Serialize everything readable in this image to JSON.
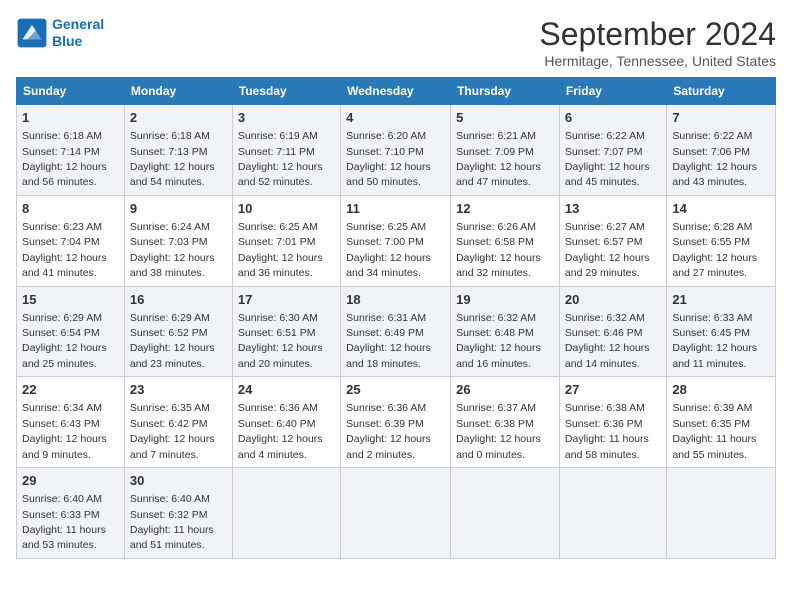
{
  "header": {
    "logo_line1": "General",
    "logo_line2": "Blue",
    "month_year": "September 2024",
    "location": "Hermitage, Tennessee, United States"
  },
  "weekdays": [
    "Sunday",
    "Monday",
    "Tuesday",
    "Wednesday",
    "Thursday",
    "Friday",
    "Saturday"
  ],
  "weeks": [
    [
      {
        "day": "1",
        "sunrise": "6:18 AM",
        "sunset": "7:14 PM",
        "daylight": "12 hours and 56 minutes."
      },
      {
        "day": "2",
        "sunrise": "6:18 AM",
        "sunset": "7:13 PM",
        "daylight": "12 hours and 54 minutes."
      },
      {
        "day": "3",
        "sunrise": "6:19 AM",
        "sunset": "7:11 PM",
        "daylight": "12 hours and 52 minutes."
      },
      {
        "day": "4",
        "sunrise": "6:20 AM",
        "sunset": "7:10 PM",
        "daylight": "12 hours and 50 minutes."
      },
      {
        "day": "5",
        "sunrise": "6:21 AM",
        "sunset": "7:09 PM",
        "daylight": "12 hours and 47 minutes."
      },
      {
        "day": "6",
        "sunrise": "6:22 AM",
        "sunset": "7:07 PM",
        "daylight": "12 hours and 45 minutes."
      },
      {
        "day": "7",
        "sunrise": "6:22 AM",
        "sunset": "7:06 PM",
        "daylight": "12 hours and 43 minutes."
      }
    ],
    [
      {
        "day": "8",
        "sunrise": "6:23 AM",
        "sunset": "7:04 PM",
        "daylight": "12 hours and 41 minutes."
      },
      {
        "day": "9",
        "sunrise": "6:24 AM",
        "sunset": "7:03 PM",
        "daylight": "12 hours and 38 minutes."
      },
      {
        "day": "10",
        "sunrise": "6:25 AM",
        "sunset": "7:01 PM",
        "daylight": "12 hours and 36 minutes."
      },
      {
        "day": "11",
        "sunrise": "6:25 AM",
        "sunset": "7:00 PM",
        "daylight": "12 hours and 34 minutes."
      },
      {
        "day": "12",
        "sunrise": "6:26 AM",
        "sunset": "6:58 PM",
        "daylight": "12 hours and 32 minutes."
      },
      {
        "day": "13",
        "sunrise": "6:27 AM",
        "sunset": "6:57 PM",
        "daylight": "12 hours and 29 minutes."
      },
      {
        "day": "14",
        "sunrise": "6:28 AM",
        "sunset": "6:55 PM",
        "daylight": "12 hours and 27 minutes."
      }
    ],
    [
      {
        "day": "15",
        "sunrise": "6:29 AM",
        "sunset": "6:54 PM",
        "daylight": "12 hours and 25 minutes."
      },
      {
        "day": "16",
        "sunrise": "6:29 AM",
        "sunset": "6:52 PM",
        "daylight": "12 hours and 23 minutes."
      },
      {
        "day": "17",
        "sunrise": "6:30 AM",
        "sunset": "6:51 PM",
        "daylight": "12 hours and 20 minutes."
      },
      {
        "day": "18",
        "sunrise": "6:31 AM",
        "sunset": "6:49 PM",
        "daylight": "12 hours and 18 minutes."
      },
      {
        "day": "19",
        "sunrise": "6:32 AM",
        "sunset": "6:48 PM",
        "daylight": "12 hours and 16 minutes."
      },
      {
        "day": "20",
        "sunrise": "6:32 AM",
        "sunset": "6:46 PM",
        "daylight": "12 hours and 14 minutes."
      },
      {
        "day": "21",
        "sunrise": "6:33 AM",
        "sunset": "6:45 PM",
        "daylight": "12 hours and 11 minutes."
      }
    ],
    [
      {
        "day": "22",
        "sunrise": "6:34 AM",
        "sunset": "6:43 PM",
        "daylight": "12 hours and 9 minutes."
      },
      {
        "day": "23",
        "sunrise": "6:35 AM",
        "sunset": "6:42 PM",
        "daylight": "12 hours and 7 minutes."
      },
      {
        "day": "24",
        "sunrise": "6:36 AM",
        "sunset": "6:40 PM",
        "daylight": "12 hours and 4 minutes."
      },
      {
        "day": "25",
        "sunrise": "6:36 AM",
        "sunset": "6:39 PM",
        "daylight": "12 hours and 2 minutes."
      },
      {
        "day": "26",
        "sunrise": "6:37 AM",
        "sunset": "6:38 PM",
        "daylight": "12 hours and 0 minutes."
      },
      {
        "day": "27",
        "sunrise": "6:38 AM",
        "sunset": "6:36 PM",
        "daylight": "11 hours and 58 minutes."
      },
      {
        "day": "28",
        "sunrise": "6:39 AM",
        "sunset": "6:35 PM",
        "daylight": "11 hours and 55 minutes."
      }
    ],
    [
      {
        "day": "29",
        "sunrise": "6:40 AM",
        "sunset": "6:33 PM",
        "daylight": "11 hours and 53 minutes."
      },
      {
        "day": "30",
        "sunrise": "6:40 AM",
        "sunset": "6:32 PM",
        "daylight": "11 hours and 51 minutes."
      },
      null,
      null,
      null,
      null,
      null
    ]
  ]
}
